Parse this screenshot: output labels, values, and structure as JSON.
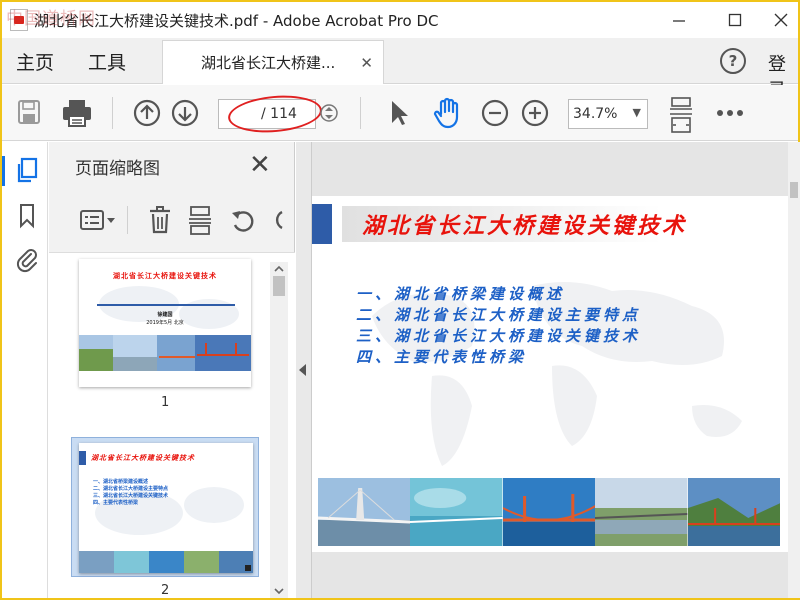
{
  "window": {
    "title": "湖北省长江大桥建设关键技术.pdf - Adobe Acrobat Pro DC",
    "watermark": "中国道桥网"
  },
  "menubar": {
    "home": "主页",
    "tools": "工具",
    "tab_label": "湖北省长江大桥建...",
    "login": "登录"
  },
  "toolbar": {
    "page_current": "",
    "page_total": "/ 114",
    "zoom": "34.7%"
  },
  "thumb_panel": {
    "title": "页面缩略图",
    "pages": [
      {
        "number": "1",
        "title": "湖北省长江大桥建设关键技术",
        "author": "徐建国",
        "date": "2019年5月 北京"
      },
      {
        "number": "2",
        "title": "湖北省长江大桥建设关键技术",
        "items": [
          "一、湖北省桥梁建设概述",
          "二、湖北省长江大桥建设主要特点",
          "三、湖北省长江大桥建设关键技术",
          "四、主要代表性桥梁"
        ]
      }
    ]
  },
  "slide": {
    "title": "湖北省长江大桥建设关键技术",
    "bullets": [
      "一、湖北省桥梁建设概述",
      "二、湖北省长江大桥建设主要特点",
      "三、湖北省长江大桥建设关键技术",
      "四、主要代表性桥梁"
    ]
  },
  "colors": {
    "accent_blue": "#1473e6",
    "slide_title_red": "#e8130c",
    "slide_bullet_blue": "#1d60c6",
    "annotation_red": "#e02020"
  },
  "icons": {
    "save": "save-icon",
    "print": "print-icon",
    "prev": "arrow-up-circle-icon",
    "next": "arrow-down-circle-icon",
    "select": "cursor-icon",
    "hand": "hand-icon",
    "zoom_out": "zoom-out-icon",
    "zoom_in": "zoom-in-icon",
    "fit": "fit-page-icon",
    "more": "more-icon"
  }
}
